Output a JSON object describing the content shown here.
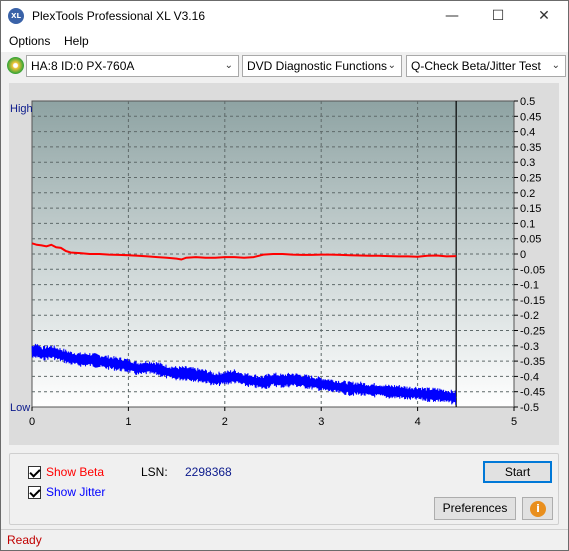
{
  "window": {
    "title": "PlexTools Professional XL V3.16",
    "app_icon_text": "XL",
    "minimize": "—",
    "maximize": "☐",
    "close": "✕"
  },
  "menu": {
    "options": "Options",
    "help": "Help"
  },
  "toolbar": {
    "drive": "HA:8 ID:0  PX-760A",
    "function": "DVD Diagnostic Functions",
    "test": "Q-Check Beta/Jitter Test",
    "arrow": "⌄"
  },
  "chart_data": {
    "type": "line",
    "left_axis_labels": {
      "top": "High",
      "bottom": "Low"
    },
    "x_ticks": [
      0,
      1,
      2,
      3,
      4,
      5
    ],
    "xlim": [
      0,
      5
    ],
    "y_ticks": [
      "0.5",
      "0.45",
      "0.4",
      "0.35",
      "0.3",
      "0.25",
      "0.2",
      "0.15",
      "0.1",
      "0.05",
      "0",
      "-0.05",
      "-0.1",
      "-0.15",
      "-0.2",
      "-0.25",
      "-0.3",
      "-0.35",
      "-0.4",
      "-0.45",
      "-0.5"
    ],
    "ylim": [
      -0.5,
      0.5
    ],
    "end_marker_x": 4.4,
    "grid": true,
    "series": [
      {
        "name": "Beta",
        "color": "#ff0000",
        "x": [
          0,
          0.05,
          0.1,
          0.15,
          0.2,
          0.25,
          0.3,
          0.35,
          0.4,
          0.5,
          0.6,
          0.7,
          0.8,
          0.9,
          1.0,
          1.1,
          1.2,
          1.3,
          1.4,
          1.5,
          1.55,
          1.6,
          1.7,
          1.8,
          1.9,
          2.0,
          2.1,
          2.2,
          2.3,
          2.4,
          2.5,
          2.6,
          2.7,
          2.8,
          2.9,
          3.0,
          3.1,
          3.2,
          3.3,
          3.4,
          3.5,
          3.6,
          3.7,
          3.8,
          3.9,
          4.0,
          4.1,
          4.2,
          4.3,
          4.4
        ],
        "values": [
          0.035,
          0.03,
          0.028,
          0.025,
          0.03,
          0.022,
          0.02,
          0.01,
          0.005,
          0.003,
          0.0,
          0.0,
          -0.002,
          -0.003,
          -0.004,
          -0.006,
          -0.008,
          -0.01,
          -0.012,
          -0.015,
          -0.018,
          -0.012,
          -0.01,
          -0.012,
          -0.012,
          -0.01,
          -0.01,
          -0.012,
          -0.01,
          -0.002,
          0.0,
          0.0,
          -0.002,
          -0.003,
          -0.003,
          -0.002,
          -0.002,
          -0.003,
          -0.004,
          -0.005,
          -0.006,
          -0.006,
          -0.007,
          -0.008,
          -0.008,
          -0.009,
          -0.006,
          -0.005,
          -0.008,
          -0.007
        ]
      },
      {
        "name": "Jitter",
        "color": "#0000ff",
        "x": [
          0,
          0.05,
          0.1,
          0.2,
          0.3,
          0.4,
          0.5,
          0.6,
          0.7,
          0.8,
          0.9,
          1.0,
          1.1,
          1.2,
          1.3,
          1.4,
          1.5,
          1.6,
          1.7,
          1.8,
          1.9,
          2.0,
          2.1,
          2.2,
          2.3,
          2.4,
          2.5,
          2.6,
          2.7,
          2.8,
          2.9,
          3.0,
          3.1,
          3.2,
          3.3,
          3.4,
          3.5,
          3.6,
          3.7,
          3.8,
          3.9,
          4.0,
          4.1,
          4.2,
          4.3,
          4.4
        ],
        "values": [
          -0.32,
          -0.315,
          -0.325,
          -0.32,
          -0.33,
          -0.34,
          -0.345,
          -0.345,
          -0.35,
          -0.355,
          -0.36,
          -0.365,
          -0.375,
          -0.37,
          -0.375,
          -0.385,
          -0.39,
          -0.39,
          -0.395,
          -0.4,
          -0.41,
          -0.405,
          -0.4,
          -0.41,
          -0.415,
          -0.42,
          -0.41,
          -0.415,
          -0.41,
          -0.415,
          -0.42,
          -0.425,
          -0.43,
          -0.435,
          -0.44,
          -0.44,
          -0.445,
          -0.445,
          -0.45,
          -0.45,
          -0.455,
          -0.455,
          -0.46,
          -0.46,
          -0.465,
          -0.47
        ]
      }
    ]
  },
  "controls": {
    "show_beta": "Show Beta",
    "show_jitter": "Show Jitter",
    "lsn_label": "LSN:",
    "lsn_value": "2298368",
    "start": "Start",
    "preferences": "Preferences",
    "info_icon_text": "i",
    "beta_color": "#ff0000",
    "jitter_color": "#0000ff"
  },
  "status": {
    "text": "Ready"
  }
}
